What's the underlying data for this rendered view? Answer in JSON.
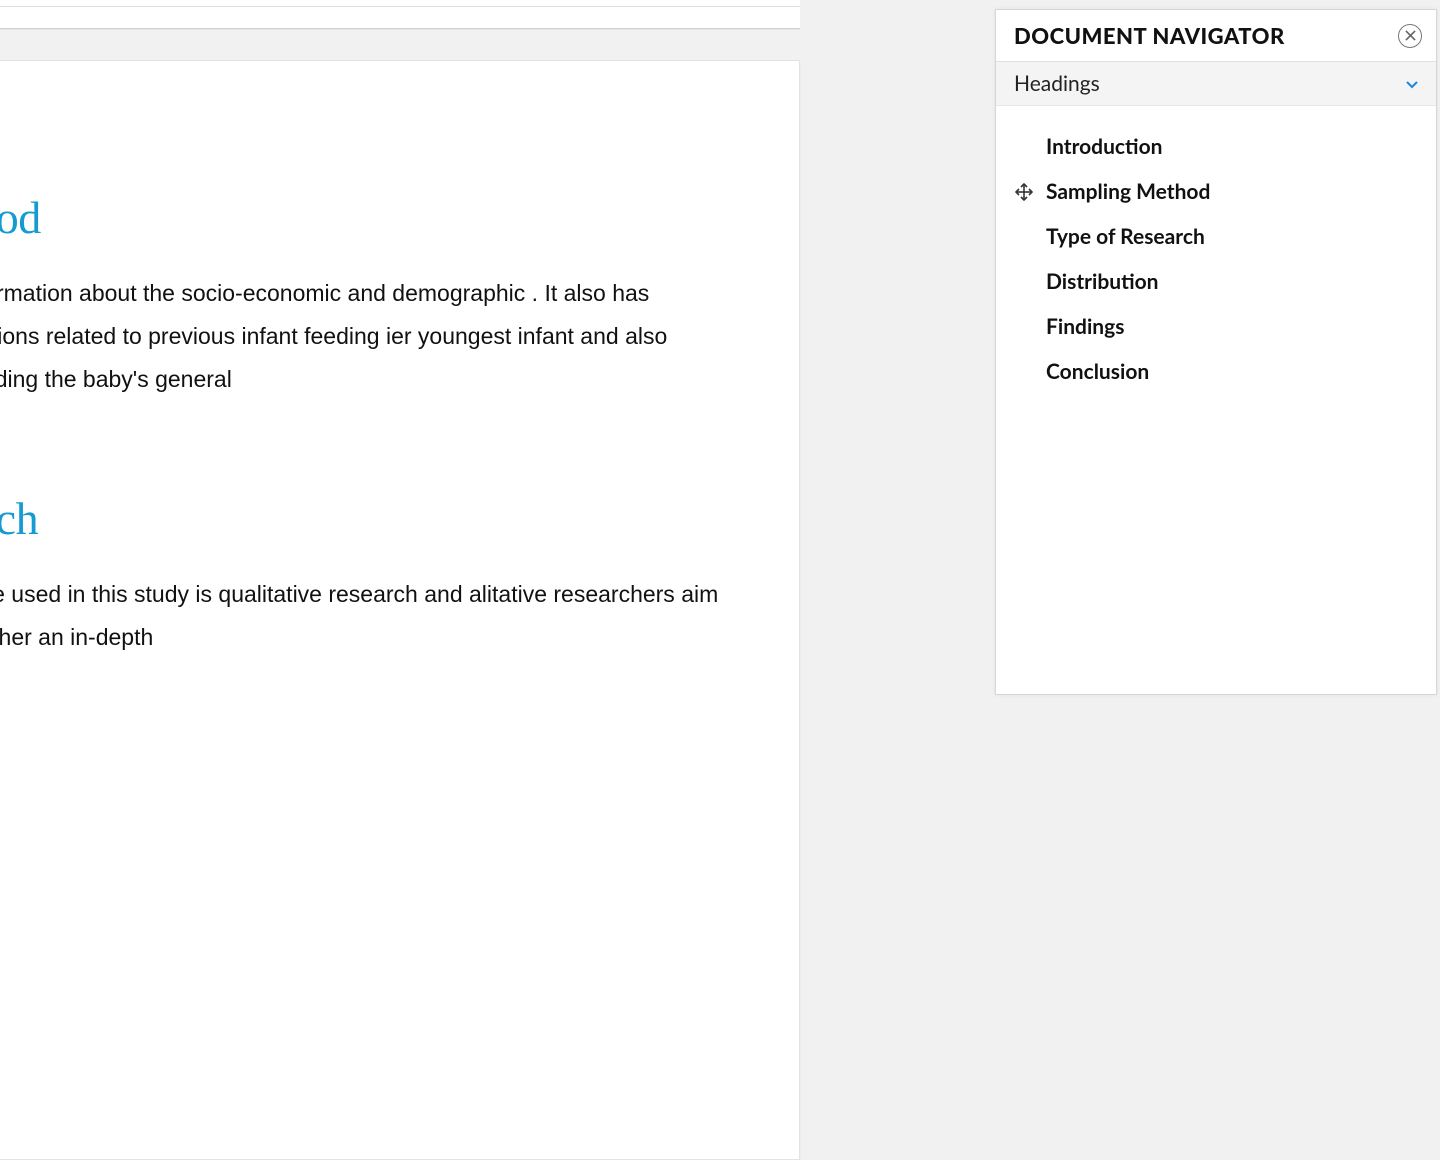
{
  "document": {
    "section1": {
      "heading": "ethod",
      "body": "s information about the socio-economic and demographic . It also has questions related to previous infant feeding ier youngest infant and also regarding the baby's general"
    },
    "section2": {
      "heading": "earch",
      "body": "will be used in this study is qualitative research and alitative researchers aim to gather an in-depth"
    }
  },
  "navigator": {
    "title": "DOCUMENT NAVIGATOR",
    "section_label": "Headings",
    "items": [
      {
        "label": "Introduction",
        "active": false
      },
      {
        "label": "Sampling Method",
        "active": true
      },
      {
        "label": "Type of Research",
        "active": false
      },
      {
        "label": "Distribution",
        "active": false
      },
      {
        "label": "Findings",
        "active": false
      },
      {
        "label": "Conclusion",
        "active": false
      }
    ]
  }
}
